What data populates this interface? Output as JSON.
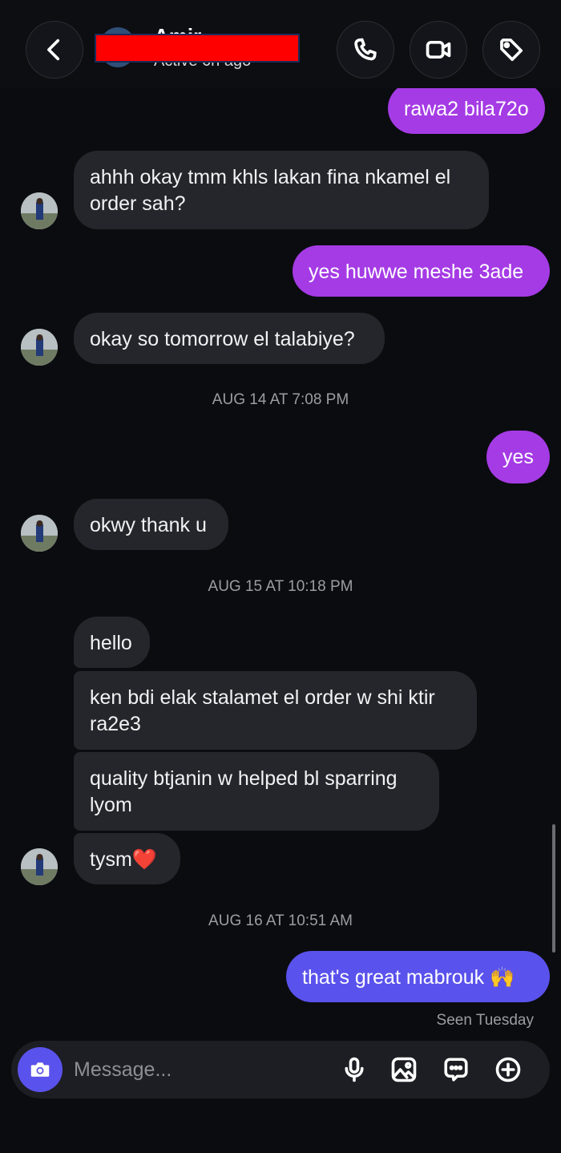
{
  "header": {
    "name": "Amir",
    "status": "Active 6h ago"
  },
  "messages": {
    "m1": "rawa2 bila72o",
    "m2": "ahhh okay tmm khls lakan fina nkamel el order sah?",
    "m3": "yes huwwe meshe 3ade",
    "m4": "okay so tomorrow el talabiye?",
    "t1": "AUG 14 AT 7:08 PM",
    "m5": "yes",
    "m6": "okwy thank u",
    "t2": "AUG 15 AT 10:18 PM",
    "m7": "hello",
    "m8": "ken bdi elak stalamet el order w shi ktir ra2e3",
    "m9": "quality btjanin w helped bl sparring lyom",
    "m10_text": "tysm",
    "m10_emoji": "❤️",
    "t3": "AUG 16 AT 10:51 AM",
    "m11_text": "that's great mabrouk",
    "m11_emoji": "🙌",
    "seen": "Seen Tuesday"
  },
  "composer": {
    "placeholder": "Message..."
  },
  "icons": {
    "back": "chevron-left-icon",
    "call": "phone-icon",
    "video": "video-camera-icon",
    "tag": "tag-icon",
    "camera": "camera-icon",
    "mic": "microphone-icon",
    "gallery": "image-icon",
    "sticker": "sticker-chat-icon",
    "plus": "plus-circle-icon"
  },
  "colors": {
    "outgoing_bubble": "#a53be5",
    "outgoing_bubble_latest": "#5a52ec",
    "incoming_bubble": "#25262b",
    "background": "#0b0c10"
  }
}
